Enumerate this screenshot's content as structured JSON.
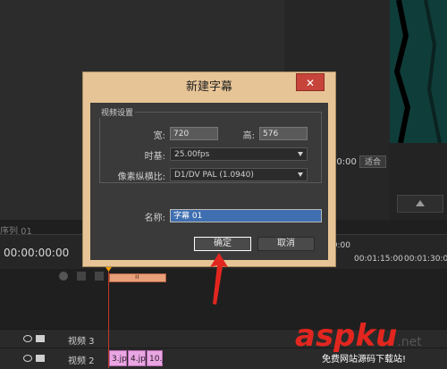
{
  "dialog": {
    "title": "新建字幕",
    "close_label": "✕",
    "group_title": "视频设置",
    "width_label": "宽:",
    "width_value": "720",
    "height_label": "高:",
    "height_value": "576",
    "timebase_label": "时基:",
    "timebase_value": "25.00fps",
    "pixel_aspect_label": "像素纵横比:",
    "pixel_aspect_value": "D1/DV PAL (1.0940)",
    "name_label": "名称:",
    "name_value": "字幕 01",
    "ok_label": "确定",
    "cancel_label": "取消"
  },
  "timeline": {
    "sequence_tab": "序列 01",
    "timecode": "00:00:00:00",
    "ruler_marks": [
      "00:01:15:00",
      "00:01:30:00"
    ],
    "ruler_left_marks": [
      "00:00"
    ],
    "tracks": [
      {
        "label": "视频 3"
      },
      {
        "label": "视频 2"
      }
    ],
    "clips": [
      "3.jp",
      "4.jp",
      "10.j"
    ]
  },
  "monitor": {
    "time_display": "00:00",
    "zoom_label": "适合"
  },
  "watermark": {
    "brand": "aspku",
    "suffix": ".net",
    "tagline": "免费网站源码下载站!"
  },
  "colors": {
    "dialog_frame": "#e7c496",
    "close_button": "#c7443a",
    "clip": "#e9a6e2",
    "playhead": "#c0392b",
    "watermark": "#e2261f"
  },
  "icons": [
    "close-icon",
    "dropdown-arrow-icon",
    "eye-icon",
    "film-icon",
    "annotation-arrow-icon"
  ]
}
